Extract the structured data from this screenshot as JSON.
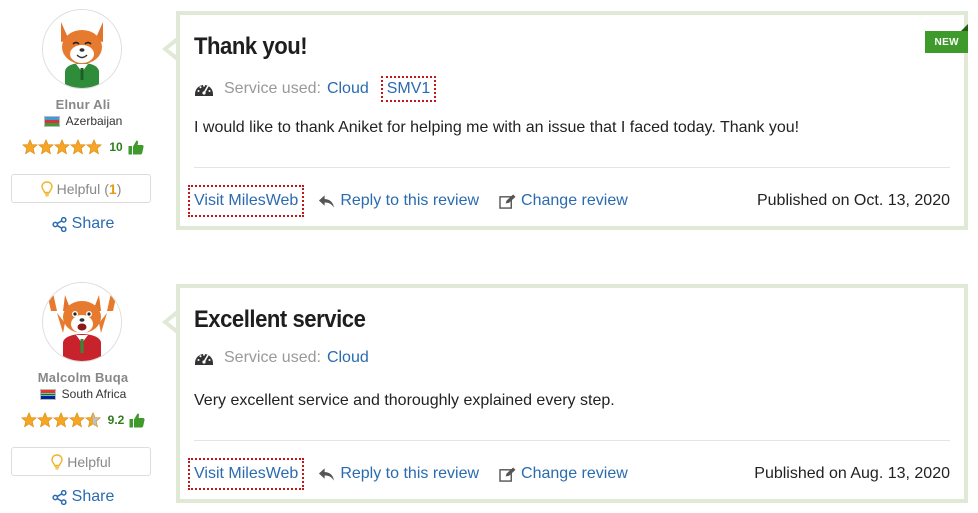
{
  "colors": {
    "link": "#2a6bb0",
    "card_border": "#dfe9d5",
    "star": "#f5a623",
    "score_green": "#2e7d1b",
    "badge_green": "#3e9a2a",
    "highlight_border": "#c01818"
  },
  "reviews": [
    {
      "author": {
        "name": "Elnur Ali",
        "country": "Azerbaijan",
        "flag_icon": "azerbaijan-flag-icon",
        "avatar_icon": "fox-avatar-smiling-icon",
        "score": "10",
        "stars": 5
      },
      "helpful": {
        "label": "Helpful",
        "open": "(",
        "count": "1",
        "close": ")"
      },
      "share_label": "Share",
      "badge": "NEW",
      "title": "Thank you!",
      "service_label": "Service used:",
      "service": "Cloud",
      "service_tag": "SMV1",
      "text": "I would like to thank Aniket for helping me with an issue that I faced today. Thank you!",
      "visit_label": "Visit MilesWeb",
      "reply_label": "Reply to this review",
      "change_label": "Change review",
      "published": "Published on Oct. 13, 2020"
    },
    {
      "author": {
        "name": "Malcolm Buqa",
        "country": "South Africa",
        "flag_icon": "south-africa-flag-icon",
        "avatar_icon": "fox-avatar-cheering-icon",
        "score": "9.2",
        "stars": 4.5
      },
      "helpful": {
        "label": "Helpful"
      },
      "share_label": "Share",
      "title": "Excellent service",
      "service_label": "Service used:",
      "service": "Cloud",
      "text": "Very excellent service and thoroughly explained every step.",
      "visit_label": "Visit MilesWeb",
      "reply_label": "Reply to this review",
      "change_label": "Change review",
      "published": "Published on Aug. 13, 2020"
    }
  ]
}
